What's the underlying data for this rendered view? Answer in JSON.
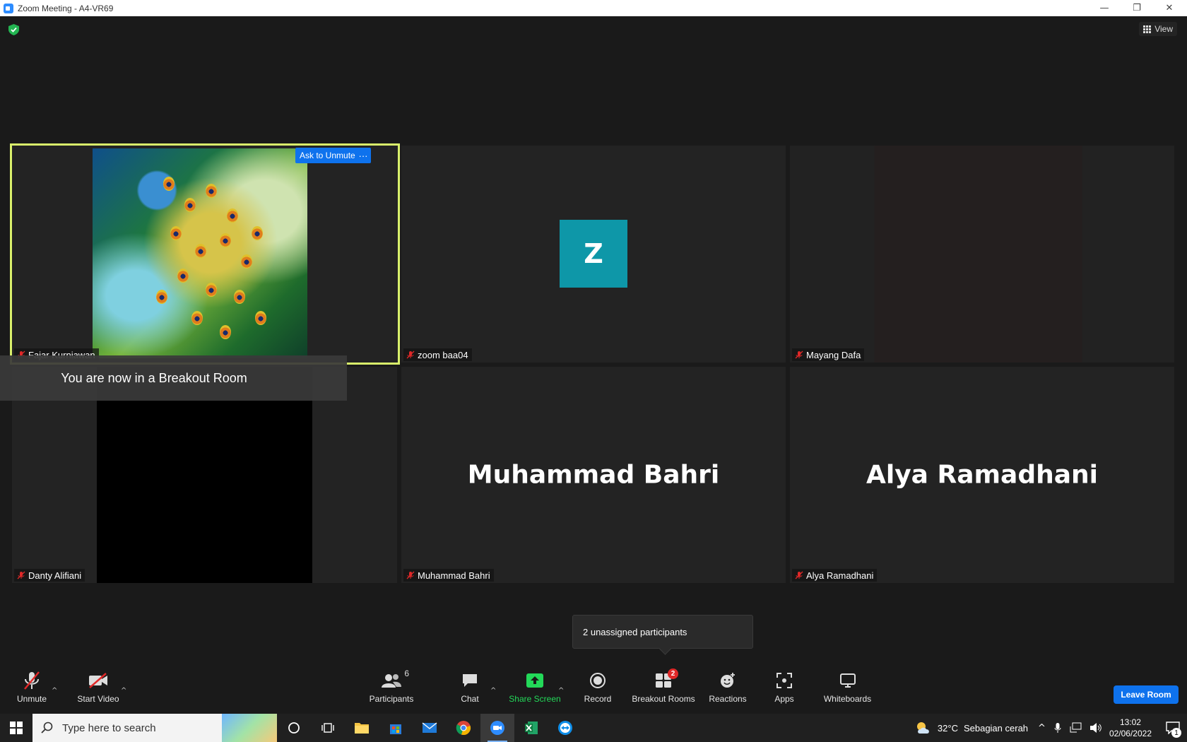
{
  "window": {
    "title": "Zoom Meeting - A4-VR69",
    "minimize": "—",
    "restore": "❐",
    "close": "✕"
  },
  "top": {
    "view_label": "View"
  },
  "tiles": [
    {
      "name": "Fajar Kurniawan",
      "muted": true,
      "active": true,
      "video": "peacock-image"
    },
    {
      "name": "zoom baa04",
      "muted": true,
      "avatar_letter": "Z"
    },
    {
      "name": "Mayang Dafa",
      "muted": true
    },
    {
      "name": "Danty Alifiani",
      "muted": true,
      "video": "black"
    },
    {
      "name": "Muhammad Bahri",
      "muted": true,
      "display_name": "Muhammad Bahri"
    },
    {
      "name": "Alya Ramadhani",
      "muted": true,
      "display_name": "Alya Ramadhani"
    }
  ],
  "tile_actions": {
    "ask_to_unmute": "Ask to Unmute",
    "more": "···"
  },
  "toast": "You are now in a Breakout Room",
  "tooltip": "2 unassigned participants",
  "toolbar": {
    "unmute": "Unmute",
    "start_video": "Start Video",
    "participants": "Participants",
    "participants_count": "6",
    "chat": "Chat",
    "share_screen": "Share Screen",
    "record": "Record",
    "breakout_rooms": "Breakout Rooms",
    "breakout_badge": "2",
    "reactions": "Reactions",
    "apps": "Apps",
    "whiteboards": "Whiteboards",
    "leave_room": "Leave Room",
    "caret": "^"
  },
  "taskbar": {
    "search_placeholder": "Type here to search",
    "weather_temp": "32°C",
    "weather_desc": "Sebagian cerah",
    "time": "13:02",
    "date": "02/06/2022",
    "notification_count": "1",
    "tray_up": "^"
  },
  "colors": {
    "active_border": "#d9f06b",
    "accent_blue": "#0e72ed",
    "share_green": "#23d959",
    "avatar_teal": "#0e97a8",
    "badge_red": "#e02828"
  }
}
